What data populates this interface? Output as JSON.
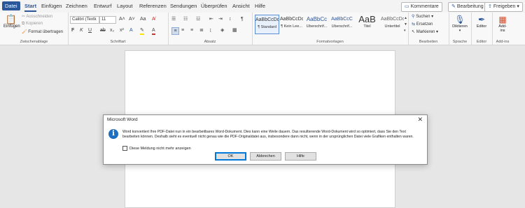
{
  "tabs": {
    "file": "Datei",
    "start": "Start",
    "insert": "Einfügen",
    "draw": "Zeichnen",
    "design": "Entwurf",
    "layout": "Layout",
    "references": "Referenzen",
    "mailings": "Sendungen",
    "review": "Überprüfen",
    "view": "Ansicht",
    "help": "Hilfe"
  },
  "top_buttons": {
    "comments": "Kommentare",
    "editing": "Bearbeitung",
    "share": "Freigeben"
  },
  "clipboard": {
    "paste": "Einfügen",
    "cut": "Ausschneiden",
    "copy": "Kopieren",
    "format_painter": "Format übertragen",
    "label": "Zwischenablage"
  },
  "font": {
    "family": "Calibri (Textk",
    "size": "11",
    "label": "Schriftart"
  },
  "paragraph": {
    "label": "Absatz"
  },
  "styles": {
    "label": "Formatvorlagen",
    "items": [
      {
        "preview": "AaBbCcDd",
        "name": "¶ Standard"
      },
      {
        "preview": "AaBbCcDd",
        "name": "¶ Kein Lee..."
      },
      {
        "preview": "AaBbCc",
        "name": "Überschrif..."
      },
      {
        "preview": "AaBbCcC",
        "name": "Überschrif..."
      },
      {
        "preview": "AaB",
        "name": "Titel"
      },
      {
        "preview": "AaBbCcDd",
        "name": "Untertitel"
      }
    ]
  },
  "editing_group": {
    "find": "Suchen",
    "replace": "Ersetzen",
    "select": "Markieren",
    "label": "Bearbeiten"
  },
  "voice": {
    "dictate": "Diktieren",
    "label": "Sprache"
  },
  "editor": {
    "button": "Editor",
    "label": "Editor"
  },
  "addins": {
    "button_line1": "Add-",
    "button_line2": "ins",
    "label": "Add-ins"
  },
  "dialog": {
    "title": "Microsoft Word",
    "message": "Word konvertiert Ihre PDF-Datei nun in ein bearbeitbares Word-Dokument. Dies kann eine Weile dauern. Das resultierende Word-Dokument wird so optimiert, dass Sie den Text bearbeiten können. Deshalb sieht es eventuell nicht genau wie die PDF-Originaldatei aus, insbesondere dann nicht, wenn in der ursprünglichen Datei viele Grafiken enthalten waren.",
    "checkbox": "Diese Meldung nicht mehr anzeigen",
    "ok": "OK",
    "cancel": "Abbrechen",
    "help": "Hilfe"
  },
  "colors": {
    "accent": "#2b579a",
    "info": "#1e6fc2"
  }
}
